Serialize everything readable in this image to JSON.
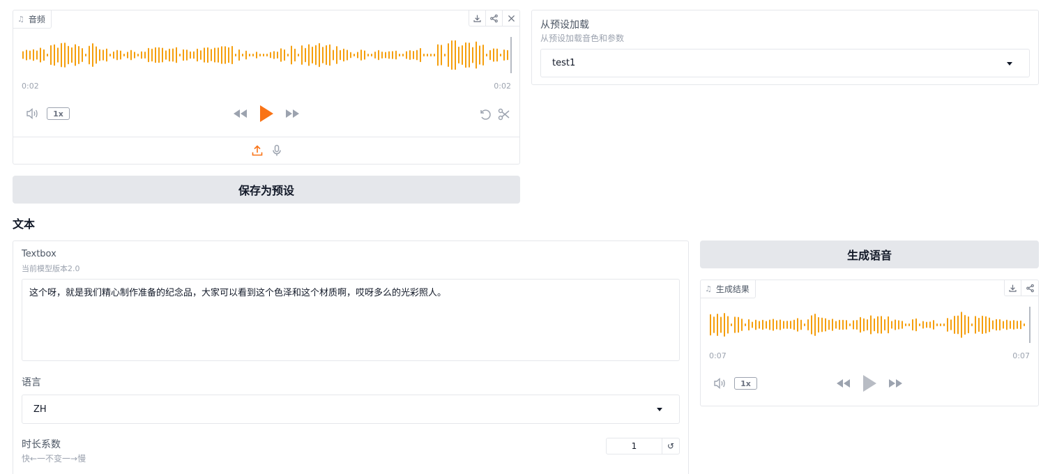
{
  "audio_input": {
    "label": "音频",
    "time_start": "0:02",
    "time_end": "0:02",
    "speed": "1x",
    "icons": [
      "download-icon",
      "share-icon",
      "close-icon",
      "volume-icon",
      "rewind-icon",
      "play-icon",
      "fast-forward-icon",
      "undo-icon",
      "scissors-icon",
      "upload-icon",
      "microphone-icon"
    ]
  },
  "preset": {
    "title": "从预设加载",
    "subtitle": "从预设加载音色和参数",
    "selected": "test1"
  },
  "save_button": "保存为预设",
  "section_title": "文本",
  "textbox": {
    "label": "Textbox",
    "info": "当前模型版本2.0",
    "value": "这个呀，就是我们精心制作准备的纪念品，大家可以看到这个色泽和这个材质啊，哎呀多么的光彩照人。"
  },
  "language": {
    "label": "语言",
    "selected": "ZH"
  },
  "duration": {
    "label": "时长系数",
    "info": "快←一不变一→慢",
    "value": "1"
  },
  "generate_button": "生成语音",
  "audio_output": {
    "label": "生成结果",
    "time_start": "0:07",
    "time_end": "0:07",
    "speed": "1x"
  },
  "colors": {
    "accent": "#f97316",
    "waveform": "#f59e0b",
    "border": "#e5e7eb",
    "button_bg": "#e5e7eb"
  }
}
